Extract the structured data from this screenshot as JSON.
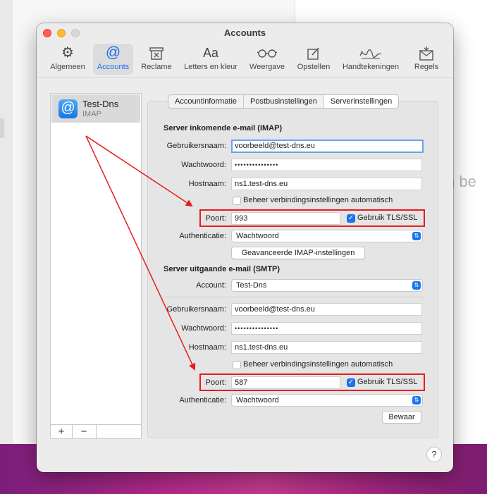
{
  "background": {
    "text": "n be"
  },
  "window": {
    "title": "Accounts"
  },
  "toolbar": {
    "items": [
      {
        "label": "Algemeen",
        "icon": "gear-icon"
      },
      {
        "label": "Accounts",
        "icon": "at-icon"
      },
      {
        "label": "Reclame",
        "icon": "junk-icon"
      },
      {
        "label": "Letters en kleur",
        "icon": "fonts-icon"
      },
      {
        "label": "Weergave",
        "icon": "glasses-icon"
      },
      {
        "label": "Opstellen",
        "icon": "compose-icon"
      },
      {
        "label": "Handtekeningen",
        "icon": "signature-icon"
      },
      {
        "label": "Regels",
        "icon": "rules-icon"
      }
    ]
  },
  "sidebar": {
    "account": {
      "name": "Test-Dns",
      "type": "IMAP"
    },
    "add_label": "+",
    "remove_label": "−"
  },
  "tabs": [
    "Accountinformatie",
    "Postbusinstellingen",
    "Serverinstellingen"
  ],
  "incoming": {
    "heading": "Server inkomende e-mail (IMAP)",
    "username_label": "Gebruikersnaam:",
    "username": "voorbeeld@test-dns.eu",
    "password_label": "Wachtwoord:",
    "password": "•••••••••••••••",
    "host_label": "Hostnaam:",
    "host": "ns1.test-dns.eu",
    "auto_label": "Beheer verbindingsinstellingen automatisch",
    "port_label": "Poort:",
    "port": "993",
    "tls_label": "Gebruik TLS/SSL",
    "auth_label": "Authenticatie:",
    "auth": "Wachtwoord",
    "advanced_label": "Geavanceerde IMAP-instellingen"
  },
  "outgoing": {
    "heading": "Server uitgaande e-mail (SMTP)",
    "account_label": "Account:",
    "account": "Test-Dns",
    "username_label": "Gebruikersnaam:",
    "username": "voorbeeld@test-dns.eu",
    "password_label": "Wachtwoord:",
    "password": "•••••••••••••••",
    "host_label": "Hostnaam:",
    "host": "ns1.test-dns.eu",
    "auto_label": "Beheer verbindingsinstellingen automatisch",
    "port_label": "Poort:",
    "port": "587",
    "tls_label": "Gebruik TLS/SSL",
    "auth_label": "Authenticatie:",
    "auth": "Wachtwoord"
  },
  "save_label": "Bewaar",
  "help_label": "?",
  "colors": {
    "accent": "#1c76f0",
    "highlight": "#e41e1e"
  }
}
